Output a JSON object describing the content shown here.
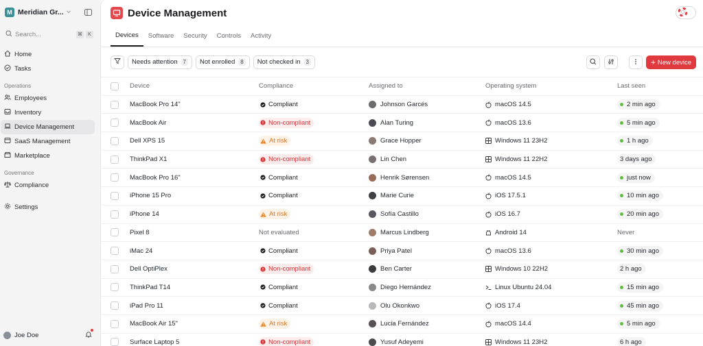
{
  "sidebar": {
    "workspace_initial": "M",
    "workspace_name": "Meridian Gr...",
    "search_placeholder": "Search...",
    "search_kbd": [
      "⌘",
      "K"
    ],
    "home": "Home",
    "tasks": "Tasks",
    "section_operations": "Operations",
    "employees": "Employees",
    "inventory": "Inventory",
    "device_management": "Device Management",
    "saas_management": "SaaS Management",
    "marketplace": "Marketplace",
    "section_governance": "Governance",
    "compliance": "Compliance",
    "settings": "Settings",
    "user_name": "Joe Doe"
  },
  "header": {
    "title": "Device Management"
  },
  "tabs": [
    "Devices",
    "Software",
    "Security",
    "Controls",
    "Activity"
  ],
  "toolbar": {
    "chips": [
      {
        "label": "Needs attention",
        "count": "7"
      },
      {
        "label": "Not enrolled",
        "count": "8"
      },
      {
        "label": "Not checked in",
        "count": "3"
      }
    ],
    "new_device": "New device"
  },
  "table": {
    "columns": [
      "Device",
      "Compliance",
      "Assigned to",
      "Operating system",
      "Last seen"
    ],
    "rows": [
      {
        "device": "MacBook Pro 14\"",
        "compliance": "Compliant",
        "assigned": "Johnson Garcés",
        "os": "macOS 14.5",
        "os_type": "apple",
        "seen": "2 min ago",
        "seen_dot": true
      },
      {
        "device": "MacBook Air",
        "compliance": "Non-compliant",
        "assigned": "Alan Turing",
        "os": "macOS 13.6",
        "os_type": "apple",
        "seen": "5 min ago",
        "seen_dot": true
      },
      {
        "device": "Dell XPS 15",
        "compliance": "At risk",
        "assigned": "Grace Hopper",
        "os": "Windows 11 23H2",
        "os_type": "windows",
        "seen": "1 h ago",
        "seen_dot": true
      },
      {
        "device": "ThinkPad X1",
        "compliance": "Non-compliant",
        "assigned": "Lin Chen",
        "os": "Windows 11 22H2",
        "os_type": "windows",
        "seen": "3 days ago",
        "seen_dot": false
      },
      {
        "device": "MacBook Pro 16\"",
        "compliance": "Compliant",
        "assigned": "Henrik Sørensen",
        "os": "macOS 14.5",
        "os_type": "apple",
        "seen": "just now",
        "seen_dot": true
      },
      {
        "device": "iPhone 15 Pro",
        "compliance": "Compliant",
        "assigned": "Marie Curie",
        "os": "iOS 17.5.1",
        "os_type": "apple",
        "seen": "10 min ago",
        "seen_dot": true
      },
      {
        "device": "iPhone 14",
        "compliance": "At risk",
        "assigned": "Sofía Castillo",
        "os": "iOS 16.7",
        "os_type": "apple",
        "seen": "20 min ago",
        "seen_dot": true
      },
      {
        "device": "Pixel 8",
        "compliance": "Not evaluated",
        "assigned": "Marcus Lindberg",
        "os": "Android 14",
        "os_type": "android",
        "seen": "Never",
        "seen_dot": false
      },
      {
        "device": "iMac 24",
        "compliance": "Compliant",
        "assigned": "Priya Patel",
        "os": "macOS 13.6",
        "os_type": "apple",
        "seen": "30 min ago",
        "seen_dot": true
      },
      {
        "device": "Dell OptiPlex",
        "compliance": "Non-compliant",
        "assigned": "Ben Carter",
        "os": "Windows 10 22H2",
        "os_type": "windows",
        "seen": "2 h ago",
        "seen_dot": false
      },
      {
        "device": "ThinkPad T14",
        "compliance": "Compliant",
        "assigned": "Diego Hernández",
        "os": "Linux Ubuntu 24.04",
        "os_type": "linux",
        "seen": "15 min ago",
        "seen_dot": true
      },
      {
        "device": "iPad Pro 11",
        "compliance": "Compliant",
        "assigned": "Olu Okonkwo",
        "os": "iOS 17.4",
        "os_type": "apple",
        "seen": "45 min ago",
        "seen_dot": true
      },
      {
        "device": "MacBook Air 15\"",
        "compliance": "At risk",
        "assigned": "Lucia Fernández",
        "os": "macOS 14.4",
        "os_type": "apple",
        "seen": "5 min ago",
        "seen_dot": true
      },
      {
        "device": "Surface Laptop 5",
        "compliance": "Non-compliant",
        "assigned": "Yusuf Adeyemi",
        "os": "Windows 11 23H2",
        "os_type": "windows",
        "seen": "6 h ago",
        "seen_dot": false
      }
    ]
  },
  "colors": {
    "accent": "#e03a3e",
    "workspace": "#3a8f98",
    "online": "#5bbf3d"
  }
}
